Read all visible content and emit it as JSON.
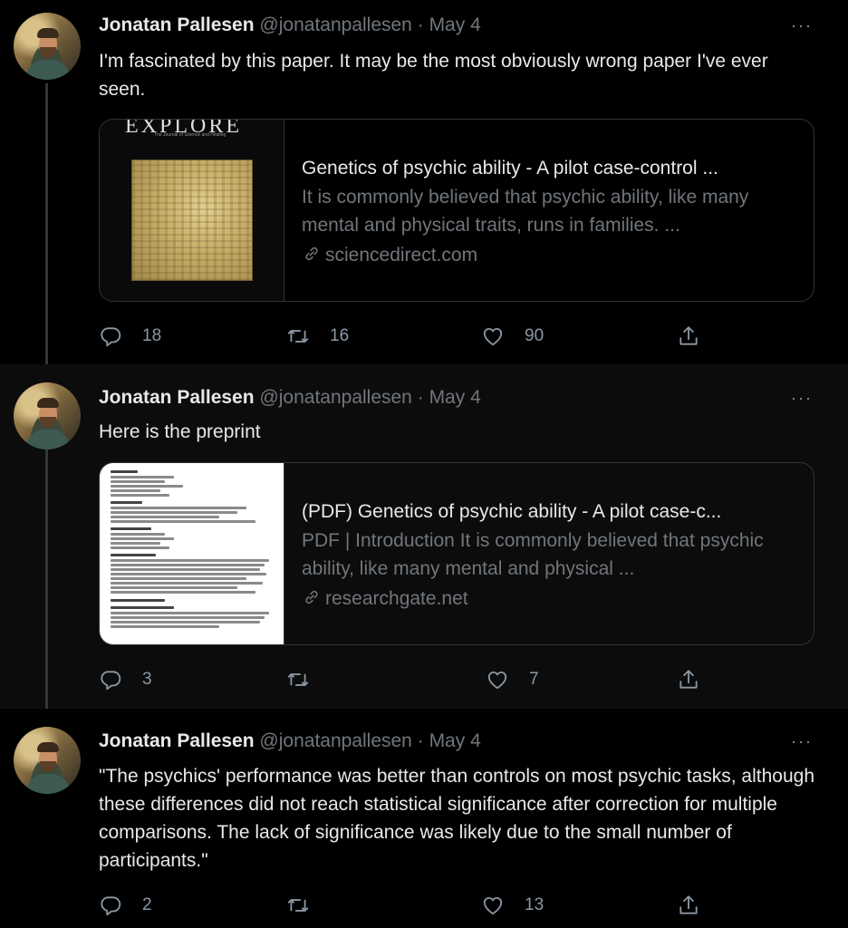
{
  "tweets": [
    {
      "name": "Jonatan Pallesen",
      "handle": "@jonatanpallesen",
      "separator": "·",
      "date": "May 4",
      "more": "···",
      "text": "I'm fascinated by this paper. It may be the most obviously wrong paper I've ever seen.",
      "card": {
        "thumb_masthead": "EXPLORE",
        "thumb_tagline": "The Journal of Science and Healing",
        "title": "Genetics of psychic ability - A pilot case-control ...",
        "description": "It is commonly believed that psychic ability, like many mental and physical traits, runs in families. ...",
        "domain": "sciencedirect.com"
      },
      "replies": "18",
      "retweets": "16",
      "likes": "90"
    },
    {
      "name": "Jonatan Pallesen",
      "handle": "@jonatanpallesen",
      "separator": "·",
      "date": "May 4",
      "more": "···",
      "text": "Here is the preprint",
      "card": {
        "title": "(PDF) Genetics of psychic ability - A pilot case-c...",
        "description": "PDF | Introduction It is commonly believed that psychic ability, like many mental and physical ...",
        "domain": "researchgate.net"
      },
      "replies": "3",
      "retweets": "",
      "likes": "7"
    },
    {
      "name": "Jonatan Pallesen",
      "handle": "@jonatanpallesen",
      "separator": "·",
      "date": "May 4",
      "more": "···",
      "text": "\"The psychics' performance was better than controls on most psychic tasks, although these differences did not reach statistical significance after correction for multiple comparisons. The lack of significance was likely due to the small number of participants.\"",
      "replies": "2",
      "retweets": "",
      "likes": "13"
    }
  ],
  "icons": {
    "reply": "reply-icon",
    "retweet": "retweet-icon",
    "like": "heart-icon",
    "share": "share-icon",
    "link": "link-icon",
    "more": "more-icon"
  },
  "colors": {
    "background": "#000000",
    "text_primary": "#e7e9ea",
    "text_secondary": "#71767b",
    "border": "#2f3336"
  }
}
